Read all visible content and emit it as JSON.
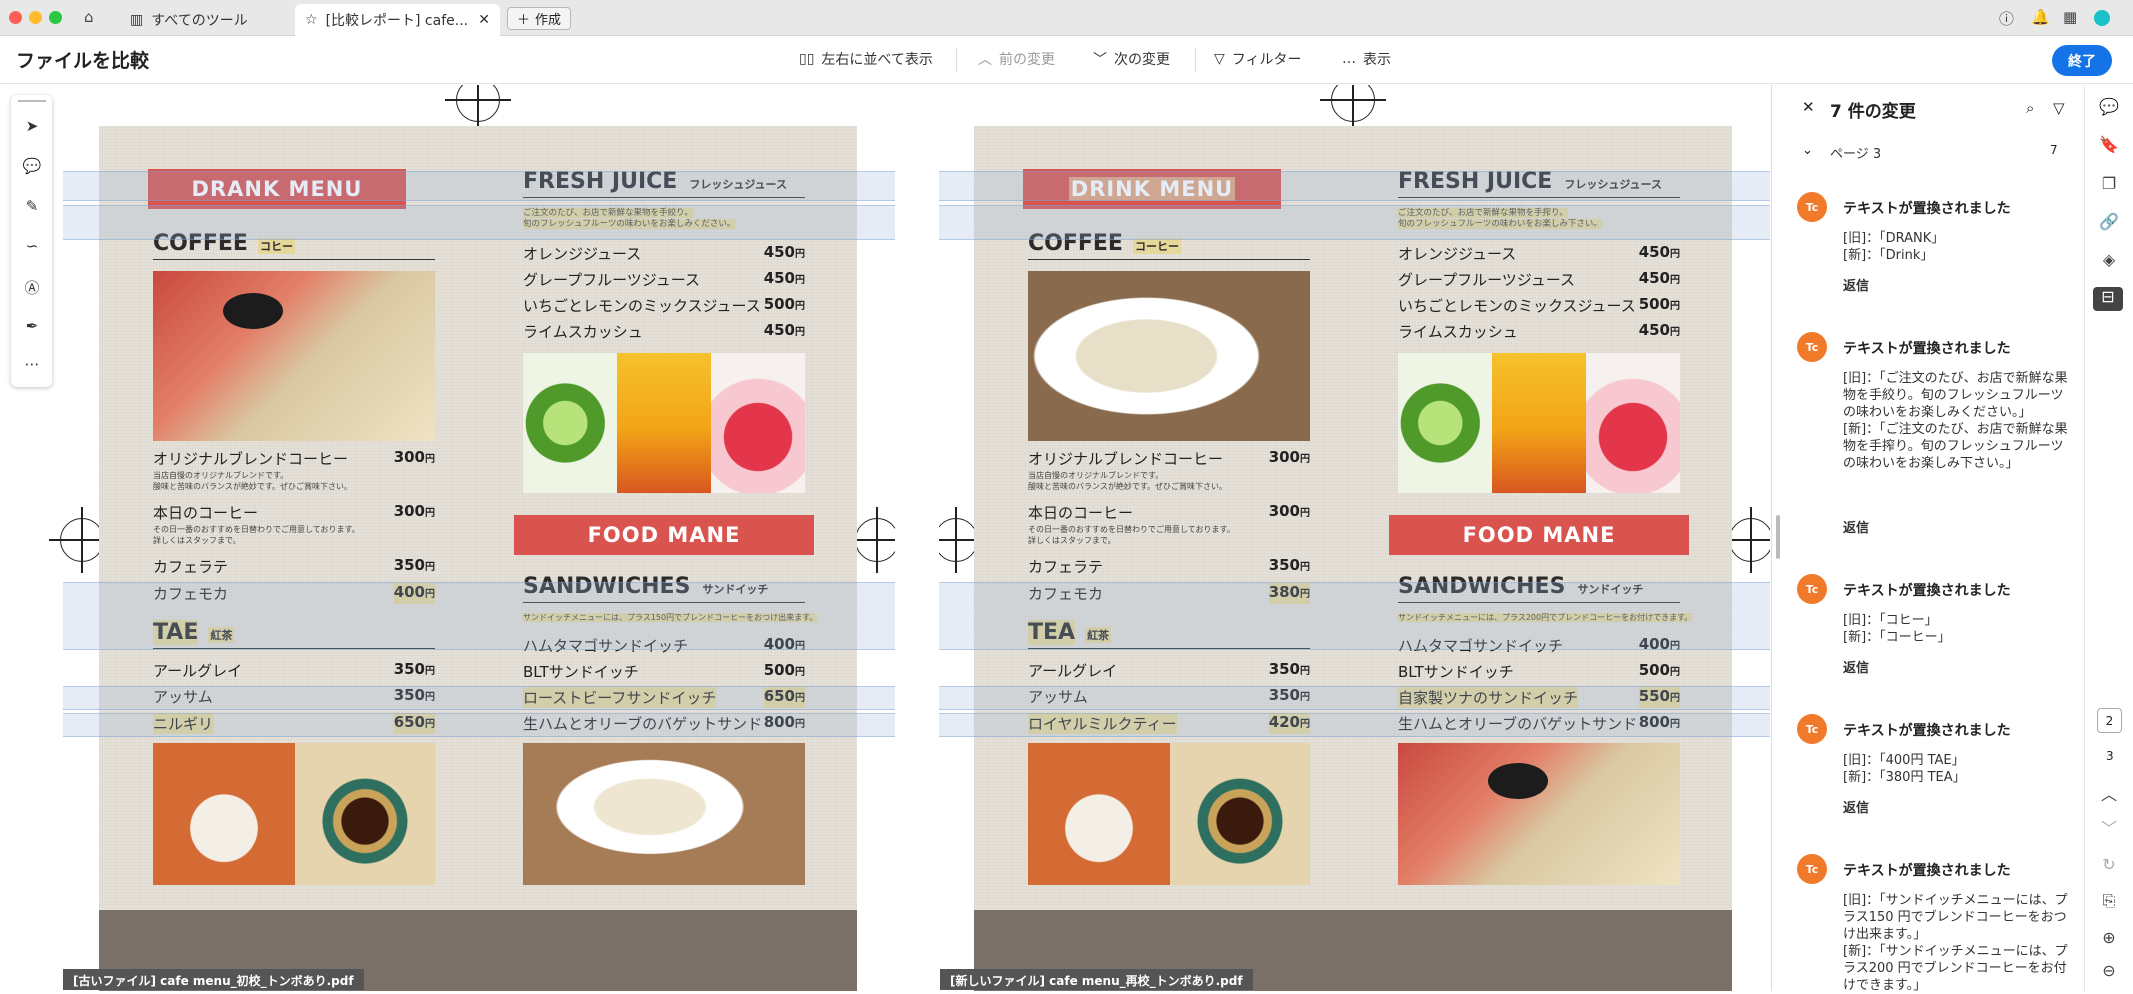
{
  "tabs": [
    {
      "label": "すべてのツール"
    },
    {
      "label": "[比較レポート] cafe..."
    }
  ],
  "new_tab": "作成",
  "toolbar": {
    "title": "ファイルを比較",
    "side_by_side": "左右に並べて表示",
    "prev": "前の変更",
    "next": "次の変更",
    "filter": "フィルター",
    "view": "表示",
    "finish": "終了"
  },
  "old_doc": {
    "filename": "[古いファイル] cafe menu_初校_トンボあり.pdf",
    "menu_ribbon": "DRANK  MENU",
    "juice_title": "FRESH JUICE",
    "juice_sub": "フレッシュジュース",
    "juice_note": "ご注文のたび、お店で新鮮な果物を手絞り。\n旬のフレッシュフルーツの味わいをお楽しみください。",
    "juices": [
      {
        "n": "オレンジジュース",
        "p": "450"
      },
      {
        "n": "グレープフルーツジュース",
        "p": "450"
      },
      {
        "n": "いちごとレモンのミックスジュース",
        "p": "500"
      },
      {
        "n": "ライムスカッシュ",
        "p": "450"
      }
    ],
    "coffee_title": "COFFEE",
    "coffee_sub": "コヒー",
    "coffee": [
      {
        "n": "オリジナルブレンドコーヒー",
        "p": "300",
        "note": "当店自慢のオリジナルブレンドです。\n酸味と苦味のバランスが絶妙です。ぜひご賞味下さい。"
      },
      {
        "n": "本日のコーヒー",
        "p": "300",
        "note": "その日一番のおすすめを日替わりでご用意しております。\n詳しくはスタッフまで。"
      },
      {
        "n": "カフェラテ",
        "p": "350",
        "note": ""
      },
      {
        "n": "カフェモカ",
        "p": "400",
        "note": ""
      }
    ],
    "food_ribbon": "FOOD MANE",
    "sand_title": "SANDWICHES",
    "sand_sub": "サンドイッチ",
    "sand_note": "サンドイッチメニューには、プラス150円でブレンドコーヒーをおつけ出来ます。",
    "sand": [
      {
        "n": "ハムタマゴサンドイッチ",
        "p": "400"
      },
      {
        "n": "BLTサンドイッチ",
        "p": "500"
      },
      {
        "n": "ローストビーフサンドイッチ",
        "p": "650"
      },
      {
        "n": "生ハムとオリーブのバゲットサンド",
        "p": "800"
      }
    ],
    "tea_title": "TAE",
    "tea_sub": "紅茶",
    "tea": [
      {
        "n": "アールグレイ",
        "p": "350"
      },
      {
        "n": "アッサム",
        "p": "350"
      },
      {
        "n": "ニルギリ",
        "p": "650"
      }
    ]
  },
  "new_doc": {
    "filename": "[新しいファイル] cafe menu_再校_トンボあり.pdf",
    "menu_ribbon": "DRINK  MENU",
    "juice_title": "FRESH JUICE",
    "juice_sub": "フレッシュジュース",
    "juice_note": "ご注文のたび、お店で新鮮な果物を手搾り。\n旬のフレッシュフルーツの味わいをお楽しみ下さい。",
    "juices": [
      {
        "n": "オレンジジュース",
        "p": "450"
      },
      {
        "n": "グレープフルーツジュース",
        "p": "450"
      },
      {
        "n": "いちごとレモンのミックスジュース",
        "p": "500"
      },
      {
        "n": "ライムスカッシュ",
        "p": "450"
      }
    ],
    "coffee_title": "COFFEE",
    "coffee_sub": "コーヒー",
    "coffee": [
      {
        "n": "オリジナルブレンドコーヒー",
        "p": "300",
        "note": "当店自慢のオリジナルブレンドです。\n酸味と苦味のバランスが絶妙です。ぜひご賞味下さい。"
      },
      {
        "n": "本日のコーヒー",
        "p": "300",
        "note": "その日一番のおすすめを日替わりでご用意しております。\n詳しくはスタッフまで。"
      },
      {
        "n": "カフェラテ",
        "p": "350",
        "note": ""
      },
      {
        "n": "カフェモカ",
        "p": "380",
        "note": ""
      }
    ],
    "food_ribbon": "FOOD MANE",
    "sand_title": "SANDWICHES",
    "sand_sub": "サンドイッチ",
    "sand_note": "サンドイッチメニューには、プラス200円でブレンドコーヒーをお付けできます。",
    "sand": [
      {
        "n": "ハムタマゴサンドイッチ",
        "p": "400"
      },
      {
        "n": "BLTサンドイッチ",
        "p": "500"
      },
      {
        "n": "自家製ツナのサンドイッチ",
        "p": "550"
      },
      {
        "n": "生ハムとオリーブのバゲットサンド",
        "p": "800"
      }
    ],
    "tea_title": "TEA",
    "tea_sub": "紅茶",
    "tea": [
      {
        "n": "アールグレイ",
        "p": "350"
      },
      {
        "n": "アッサム",
        "p": "350"
      },
      {
        "n": "ロイヤルミルクティー",
        "p": "420"
      }
    ]
  },
  "panel": {
    "title": "7 件の変更",
    "group": "ページ 3",
    "count": "7",
    "reply": "返信",
    "changes": [
      {
        "title": "テキストが置換されました",
        "body": "[旧]：「DRANK」\n[新]：「Drink」"
      },
      {
        "title": "テキストが置換されました",
        "body": "[旧]：「ご注文のたび、お店で新鮮な果物を手絞り。旬のフレッシュフルーツの味わいをお楽しみください。」\n[新]：「ご注文のたび、お店で新鮮な果物を手搾り。旬のフレッシュフルーツの味わいをお楽しみ下さい。」"
      },
      {
        "title": "テキストが置換されました",
        "body": "[旧]：「コヒー」\n[新]：「コーヒー」"
      },
      {
        "title": "テキストが置換されました",
        "body": "[旧]：「400円 TAE」\n[新]：「380円 TEA」"
      },
      {
        "title": "テキストが置換されました",
        "body": "[旧]：「サンドイッチメニューには、プラス150 円でブレンドコーヒーをおつけ出来ます。」\n[新]：「サンドイッチメニューには、プラス200 円でブレンドコーヒーをお付けできます。」"
      }
    ]
  },
  "rail": {
    "page_current": "2",
    "page_next": "3"
  },
  "colors": {
    "accent": "#1473e6",
    "ribbon": "#d9534f",
    "avatar": "#f07a2a"
  }
}
